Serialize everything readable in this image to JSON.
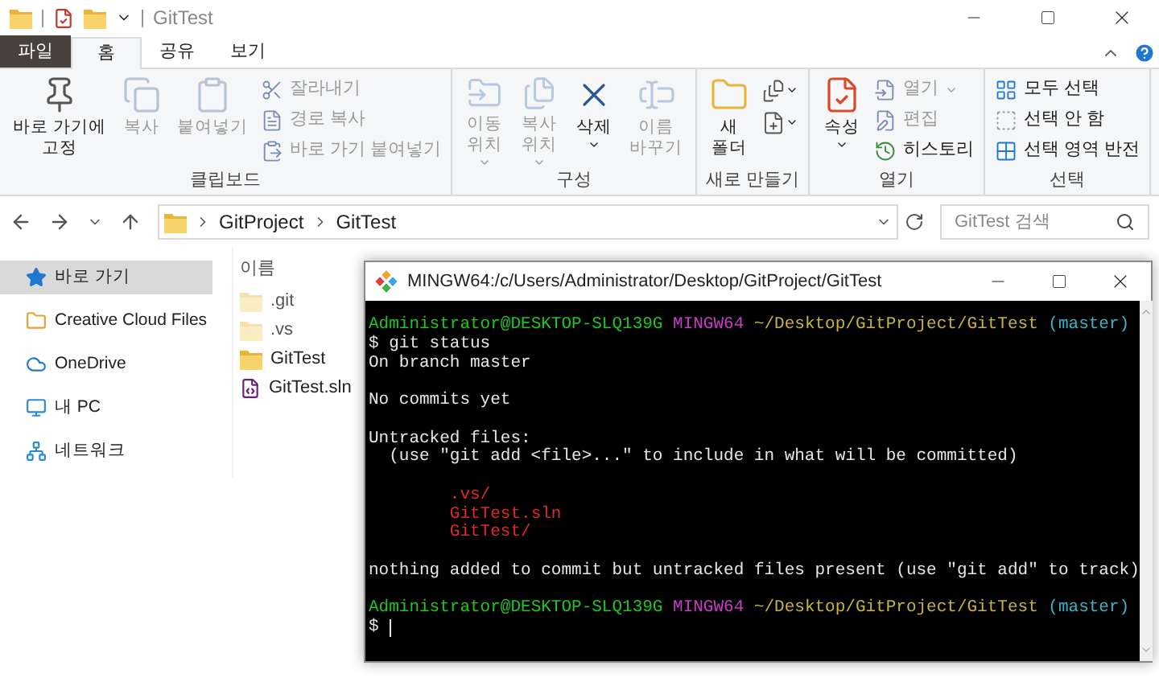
{
  "window": {
    "title": "GitTest"
  },
  "ribbon_tabs": [
    {
      "label": "파일",
      "kind": "file",
      "selected": false
    },
    {
      "label": "홈",
      "kind": "tab",
      "selected": true
    },
    {
      "label": "공유",
      "kind": "tab",
      "selected": false
    },
    {
      "label": "보기",
      "kind": "tab",
      "selected": false
    }
  ],
  "ribbon_groups": [
    {
      "label": "클립보드",
      "items": [
        {
          "kind": "large",
          "label": "바로 가기에\n고정",
          "disabled": false,
          "dropdown": false
        },
        {
          "kind": "large",
          "label": "복사",
          "disabled": true,
          "dropdown": false
        },
        {
          "kind": "large",
          "label": "붙여넣기",
          "disabled": true,
          "dropdown": false
        },
        {
          "kind": "small",
          "label": "잘라내기",
          "disabled": true,
          "dropdown": false
        },
        {
          "kind": "small",
          "label": "경로 복사",
          "disabled": true,
          "dropdown": false
        },
        {
          "kind": "small",
          "label": "바로 가기 붙여넣기",
          "disabled": true,
          "dropdown": false
        }
      ]
    },
    {
      "label": "구성",
      "items": [
        {
          "kind": "large",
          "label": "이동\n위치",
          "disabled": true,
          "dropdown": true
        },
        {
          "kind": "large",
          "label": "복사\n위치",
          "disabled": true,
          "dropdown": true
        },
        {
          "kind": "large",
          "label": "삭제",
          "disabled": false,
          "dropdown": true
        },
        {
          "kind": "large",
          "label": "이름\n바꾸기",
          "disabled": true,
          "dropdown": false
        }
      ]
    },
    {
      "label": "새로 만들기",
      "items": [
        {
          "kind": "large",
          "label": "새\n폴더",
          "disabled": false,
          "dropdown": false
        },
        {
          "kind": "icon",
          "disabled": false,
          "dropdown": true
        },
        {
          "kind": "icon",
          "disabled": false,
          "dropdown": true
        }
      ]
    },
    {
      "label": "열기",
      "items": [
        {
          "kind": "large",
          "label": "속성",
          "disabled": false,
          "dropdown": true
        },
        {
          "kind": "small",
          "label": "열기",
          "disabled": true,
          "dropdown": true
        },
        {
          "kind": "small",
          "label": "편집",
          "disabled": true,
          "dropdown": false
        },
        {
          "kind": "small",
          "label": "히스토리",
          "disabled": false,
          "dropdown": false
        }
      ]
    },
    {
      "label": "선택",
      "items": [
        {
          "kind": "small",
          "label": "모두 선택",
          "disabled": false,
          "dropdown": false
        },
        {
          "kind": "small",
          "label": "선택 안 함",
          "disabled": false,
          "dropdown": false
        },
        {
          "kind": "small",
          "label": "선택 영역 반전",
          "disabled": false,
          "dropdown": false
        }
      ]
    }
  ],
  "address_bar": {
    "path": [
      "GitProject",
      "GitTest"
    ],
    "search_placeholder": "GitTest 검색"
  },
  "nav_pane": [
    {
      "label": "바로 가기",
      "selected": true
    },
    {
      "label": "Creative Cloud Files",
      "selected": false
    },
    {
      "label": "OneDrive",
      "selected": false
    },
    {
      "label": "내 PC",
      "selected": false
    },
    {
      "label": "네트워크",
      "selected": false
    }
  ],
  "file_list": {
    "column_header": "이름",
    "files": [
      {
        "name": ".git",
        "kind": "folder",
        "hidden": true
      },
      {
        "name": ".vs",
        "kind": "folder",
        "hidden": true
      },
      {
        "name": "GitTest",
        "kind": "folder",
        "hidden": false
      },
      {
        "name": "GitTest.sln",
        "kind": "solution",
        "hidden": false
      }
    ]
  },
  "terminal": {
    "title": "MINGW64:/c/Users/Administrator/Desktop/GitProject/GitTest",
    "lines": [
      {
        "kind": "text",
        "segments": [
          {
            "text": "Administrator@DESKTOP-SLQ139G",
            "color": "#1ec81e"
          },
          {
            "text": "MINGW64",
            "color": "#c83cc8"
          },
          {
            "text": "~/Desktop/GitProject/GitTest",
            "color": "#c8b43c"
          },
          {
            "text": "(master)",
            "color": "#3cb4c8"
          }
        ]
      },
      {
        "kind": "text",
        "segments": [
          {
            "text": "$ git status",
            "color": "#e6e6e6"
          }
        ]
      },
      {
        "kind": "text",
        "segments": [
          {
            "text": "On branch master",
            "color": "#e6e6e6"
          }
        ]
      },
      {
        "kind": "blank"
      },
      {
        "kind": "text",
        "segments": [
          {
            "text": "No commits yet",
            "color": "#e6e6e6"
          }
        ]
      },
      {
        "kind": "blank"
      },
      {
        "kind": "text",
        "segments": [
          {
            "text": "Untracked files:",
            "color": "#e6e6e6"
          }
        ]
      },
      {
        "kind": "hint",
        "segments": [
          {
            "text": "(use \"git add <file>...\" to include in what will be committed)",
            "color": "#e6e6e6"
          }
        ]
      },
      {
        "kind": "blank"
      },
      {
        "kind": "file",
        "segments": [
          {
            "text": ".vs/",
            "color": "#e02828"
          }
        ]
      },
      {
        "kind": "file",
        "segments": [
          {
            "text": "GitTest.sln",
            "color": "#e02828"
          }
        ]
      },
      {
        "kind": "file",
        "segments": [
          {
            "text": "GitTest/",
            "color": "#e02828"
          }
        ]
      },
      {
        "kind": "blank"
      },
      {
        "kind": "text",
        "segments": [
          {
            "text": "nothing added to commit but untracked files present (use \"git add\" to track)",
            "color": "#e6e6e6"
          }
        ]
      },
      {
        "kind": "blank"
      },
      {
        "kind": "text",
        "segments": [
          {
            "text": "Administrator@DESKTOP-SLQ139G",
            "color": "#1ec81e"
          },
          {
            "text": "MINGW64",
            "color": "#c83cc8"
          },
          {
            "text": "~/Desktop/GitProject/GitTest",
            "color": "#c8b43c"
          },
          {
            "text": "(master)",
            "color": "#3cb4c8"
          }
        ]
      },
      {
        "kind": "cursor",
        "segments": [
          {
            "text": "$",
            "color": "#e6e6e6"
          }
        ]
      }
    ]
  }
}
